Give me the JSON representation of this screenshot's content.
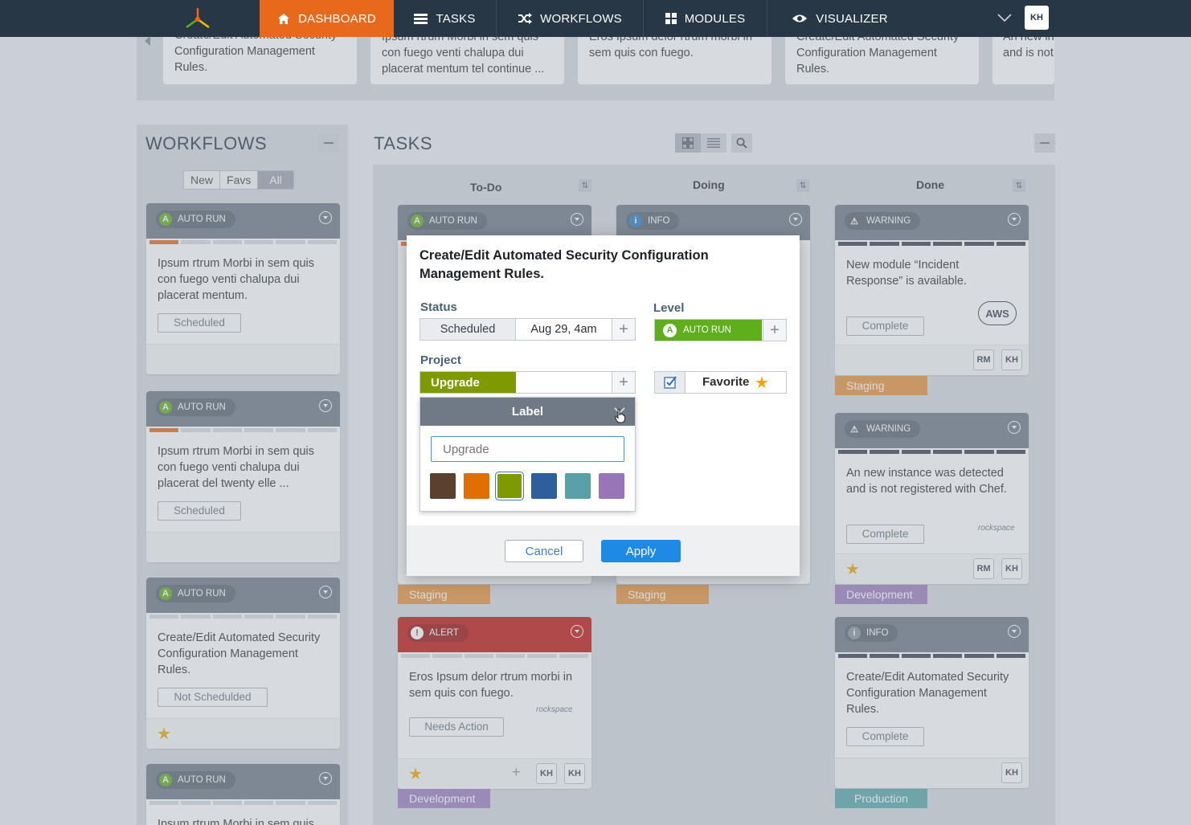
{
  "nav": {
    "items": [
      {
        "label": "DASHBOARD",
        "icon": "home-icon"
      },
      {
        "label": "TASKS",
        "icon": "tasks-icon"
      },
      {
        "label": "WORKFLOWS",
        "icon": "shuffle-icon"
      },
      {
        "label": "MODULES",
        "icon": "grid-icon"
      },
      {
        "label": "VISUALIZER",
        "icon": "eye-icon"
      }
    ],
    "user_initials": "KH",
    "colors": {
      "bar": "#283746",
      "active": "#e8681c"
    }
  },
  "carousel": {
    "cards": [
      {
        "line1": "Create/Edit Automated Security",
        "line2": "Configuration Management",
        "line3": "Rules."
      },
      {
        "line1": "Ipsum rtrum Morbi in sem quis",
        "line2": "con fuego venti chalupa dui",
        "line3": "placerat mentum tel continue ..."
      },
      {
        "line1": "Eros Ipsum delor rtrum morbi in",
        "line2": "sem quis con fuego.",
        "line3": ""
      },
      {
        "line1": "Create/Edit Automated Security",
        "line2": "Configuration Management",
        "line3": "Rules."
      },
      {
        "line1": "An new in",
        "line2": "and is not",
        "line3": ""
      }
    ]
  },
  "workflows": {
    "title": "WORKFLOWS",
    "filters": [
      "New",
      "Favs",
      "All"
    ],
    "selected_filter": "All",
    "cards": [
      {
        "badge": "AUTO RUN",
        "lines": [
          "Ipsum rtrum Morbi in sem quis",
          "con fuego venti chalupa dui",
          "placerat mentum."
        ],
        "status": "Scheduled"
      },
      {
        "badge": "AUTO RUN",
        "lines": [
          "Ipsum rtrum Morbi in sem quis",
          "con fuego venti chalupa dui",
          "placerat del twenty elle ..."
        ],
        "status": "Scheduled"
      },
      {
        "badge": "AUTO RUN",
        "lines": [
          "Create/Edit Automated Security",
          "Configuration Management",
          "Rules."
        ],
        "status": "Not Schedulded"
      },
      {
        "badge": "AUTO RUN",
        "lines": [
          "Ipsum rtrum Morbi in sem quis"
        ],
        "status": ""
      }
    ]
  },
  "tasks": {
    "title": "TASKS",
    "columns": [
      "To-Do",
      "Doing",
      "Done"
    ],
    "todo": [
      {
        "badge": "AUTO RUN",
        "label": "Staging"
      },
      {
        "badge": "ALERT",
        "lines": [
          "Eros Ipsum delor rtrum morbi in",
          "sem quis con fuego."
        ],
        "status": "Needs Action",
        "logo": "rockspace",
        "assignees": [
          "KH",
          "KH"
        ],
        "label": "Development"
      }
    ],
    "doing": [
      {
        "badge": "INFO",
        "label": "Staging"
      }
    ],
    "done": [
      {
        "badge": "WARNING",
        "lines": [
          "New module “Incident",
          "Response” is available."
        ],
        "status": "Complete",
        "logo": "AWS",
        "assignees": [
          "RM",
          "KH"
        ],
        "label": "Staging"
      },
      {
        "badge": "WARNING",
        "lines": [
          "An new instance was detected",
          "and is not registered with Chef."
        ],
        "status": "Complete",
        "logo": "rockspace",
        "assignees": [
          "RM",
          "KH"
        ],
        "label": "Development"
      },
      {
        "badge": "INFO",
        "lines": [
          "Create/Edit Automated Security",
          "Configuration Management",
          "Rules."
        ],
        "status": "Complete",
        "assignees": [
          "KH"
        ],
        "label": "Production"
      }
    ],
    "label_colors": {
      "Staging": "#e8913a",
      "Development": "#9b7cc1",
      "Production": "#5aa6ab"
    }
  },
  "modal": {
    "title_line1": "Create/Edit Automated Security Configuration",
    "title_line2": "Management Rules.",
    "status_label": "Status",
    "status_value": "Scheduled",
    "status_date": "Aug 29, 4am",
    "level_label": "Level",
    "level_value": "AUTO RUN",
    "project_label": "Project",
    "project_value": "Upgrade",
    "favorite_label": "Favorite",
    "favorite_checked": true,
    "label_popup": {
      "title": "Label",
      "input_placeholder": "Upgrade",
      "swatches": [
        "#5b4030",
        "#e06f00",
        "#7f9a00",
        "#2e5f9c",
        "#5aa0a8",
        "#9874b8"
      ],
      "selected_swatch": "#7f9a00"
    },
    "cancel_label": "Cancel",
    "apply_label": "Apply"
  }
}
